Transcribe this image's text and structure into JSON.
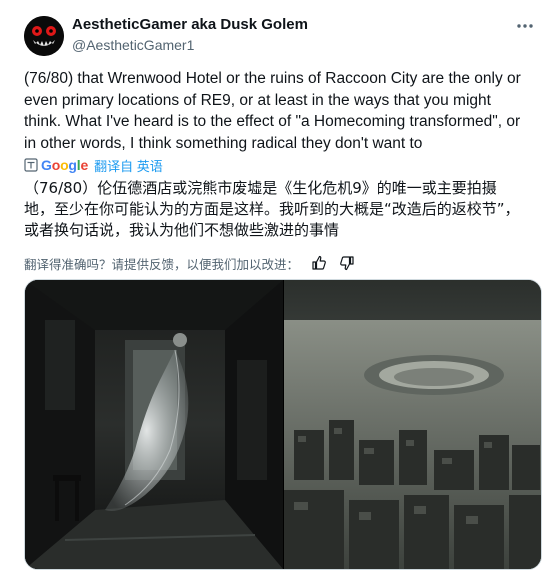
{
  "post": {
    "display_name": "AestheticGamer aka Dusk Golem",
    "handle": "@AestheticGamer1",
    "text_lines": [
      "(76/80) that Wrenwood Hotel or the ruins of Raccoon City are the only or",
      "even primary locations of RE9, or at least in the ways that you might",
      "think. What I've heard is to the effect of \"a Homecoming transformed\", or",
      "in other words, I think something radical they don't want to"
    ]
  },
  "translation": {
    "google_label": "Google",
    "translated_from": "翻译自 英语",
    "lines": [
      "（76/80）伦伍德酒店或浣熊市废墟是《生化危机9》的唯一或主要拍摄",
      "地，至少在你可能认为的方面是这样。我听到的大概是“改造后的返校节”，",
      "或者换句话说，我认为他们不想做些激进的事情"
    ],
    "feedback_prompt": "翻译得准确吗？请提供反馈，以便我们加以改进："
  },
  "icons": {
    "more": "more-icon",
    "translate": "translate-icon",
    "thumbs_up": "thumbs-up-icon",
    "thumbs_down": "thumbs-down-icon"
  },
  "colors": {
    "text": "#0f1419",
    "secondary": "#536471",
    "link": "#1d9bf0"
  }
}
